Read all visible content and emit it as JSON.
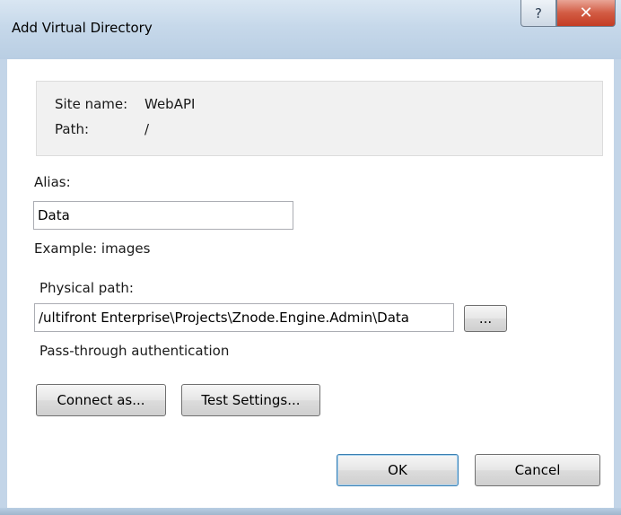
{
  "window": {
    "title": "Add Virtual Directory",
    "help_glyph": "?",
    "close_glyph": "✕"
  },
  "site_info": {
    "site_name_label": "Site name:",
    "site_name_value": "WebAPI",
    "path_label": "Path:",
    "path_value": "/"
  },
  "alias": {
    "label": "Alias:",
    "value": "Data",
    "example": "Example: images"
  },
  "physical_path": {
    "label": "Physical path:",
    "value": "/ultifront Enterprise\\Projects\\Znode.Engine.Admin\\Data",
    "browse_label": "..."
  },
  "auth": {
    "label": "Pass-through authentication",
    "connect_as_label": "Connect as...",
    "test_settings_label": "Test Settings..."
  },
  "footer": {
    "ok_label": "OK",
    "cancel_label": "Cancel"
  }
}
